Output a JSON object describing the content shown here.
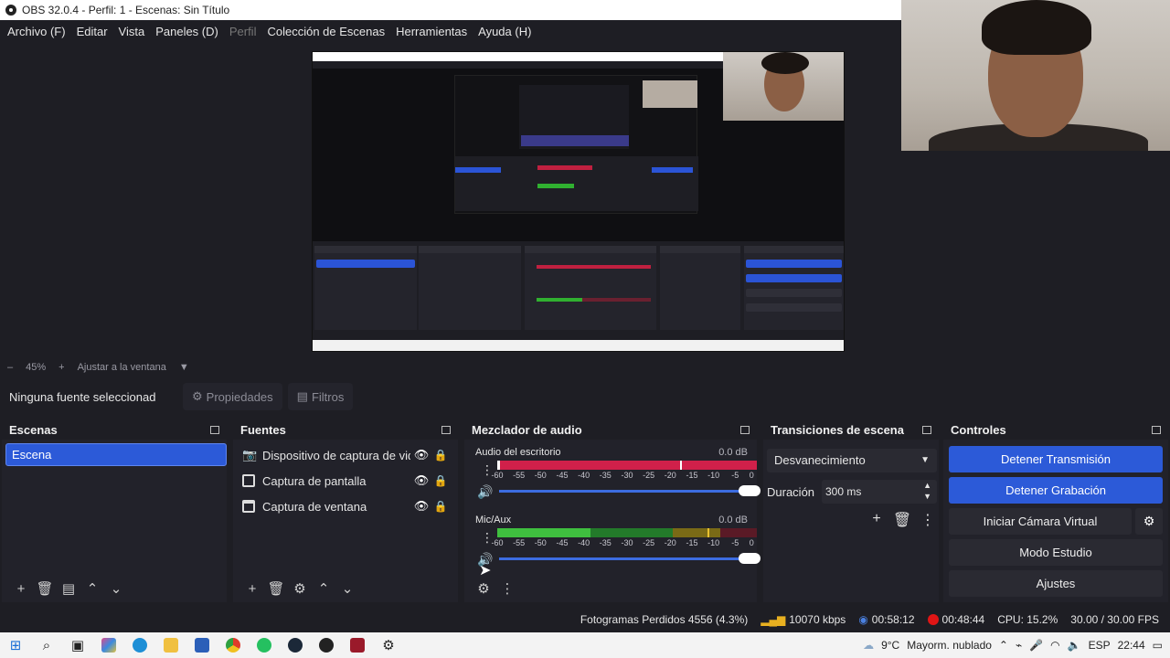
{
  "window": {
    "title": "OBS 32.0.4 - Perfil: 1 - Escenas: Sin Título"
  },
  "menu": {
    "items": [
      "Archivo (F)",
      "Editar",
      "Vista",
      "Paneles (D)",
      "Perfil",
      "Colección de Escenas",
      "Herramientas",
      "Ayuda (H)"
    ]
  },
  "zoom": {
    "minus": "–",
    "value": "45%",
    "plus": "+",
    "fit_label": "Ajustar a la ventana"
  },
  "source_toolbar": {
    "no_source": "Ninguna fuente seleccionad",
    "properties": "Propiedades",
    "filters": "Filtros"
  },
  "scenes": {
    "title": "Escenas",
    "items": [
      "Escena"
    ]
  },
  "sources": {
    "title": "Fuentes",
    "items": [
      "Dispositivo de captura de video",
      "Captura de pantalla",
      "Captura de ventana"
    ]
  },
  "mixer": {
    "title": "Mezclador de audio",
    "scale": [
      "-60",
      "-55",
      "-50",
      "-45",
      "-40",
      "-35",
      "-30",
      "-25",
      "-20",
      "-15",
      "-10",
      "-5",
      "0"
    ],
    "channels": [
      {
        "name": "Audio del escritorio",
        "db": "0.0 dB",
        "level": 0.0,
        "volume": 1.0
      },
      {
        "name": "Mic/Aux",
        "db": "0.0 dB",
        "level": 0.33,
        "volume": 1.0
      }
    ]
  },
  "transitions": {
    "title": "Transiciones de escena",
    "selected": "Desvanecimiento",
    "duration_label": "Duración",
    "duration_value": "300 ms"
  },
  "controls": {
    "title": "Controles",
    "stop_stream": "Detener Transmisión",
    "stop_record": "Detener Grabación",
    "virtual_cam": "Iniciar Cámara Virtual",
    "studio_mode": "Modo Estudio",
    "settings": "Ajustes"
  },
  "status": {
    "dropped_frames": "Fotogramas Perdidos 4556 (4.3%)",
    "bitrate": "10070 kbps",
    "stream_time": "00:58:12",
    "record_time": "00:48:44",
    "cpu": "CPU: 15.2%",
    "fps": "30.00 / 30.00 FPS"
  },
  "taskbar": {
    "weather_temp": "9°C",
    "weather_desc": "Mayorm. nublado",
    "language": "ESP",
    "time": "22:44"
  },
  "colors": {
    "accent_blue": "#2c5ad8",
    "record_red": "#e01515",
    "meter_green": "#3fbf3f",
    "meter_red": "#d0204a"
  }
}
